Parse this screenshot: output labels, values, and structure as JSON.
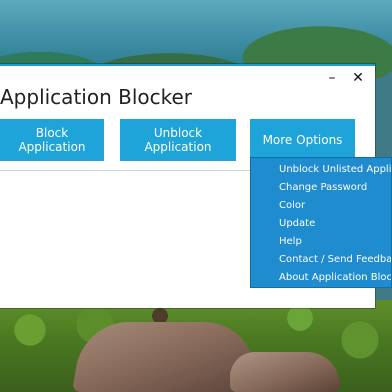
{
  "window": {
    "title": "Application Blocker",
    "minimize_icon": "–",
    "close_icon": "✕"
  },
  "toolbar": {
    "block_label": "Block Application",
    "unblock_label": "Unblock Application",
    "more_label": "More Options"
  },
  "menu": {
    "items": [
      "Unblock Unlisted Applicat",
      "Change Password",
      "Color",
      "Update",
      "Help",
      "Contact / Send Feedback",
      "About Application Blocker"
    ]
  },
  "colors": {
    "accent": "#1ea4d8",
    "menu_bg": "#1e8ccf",
    "window_border": "#1a9bd6"
  }
}
